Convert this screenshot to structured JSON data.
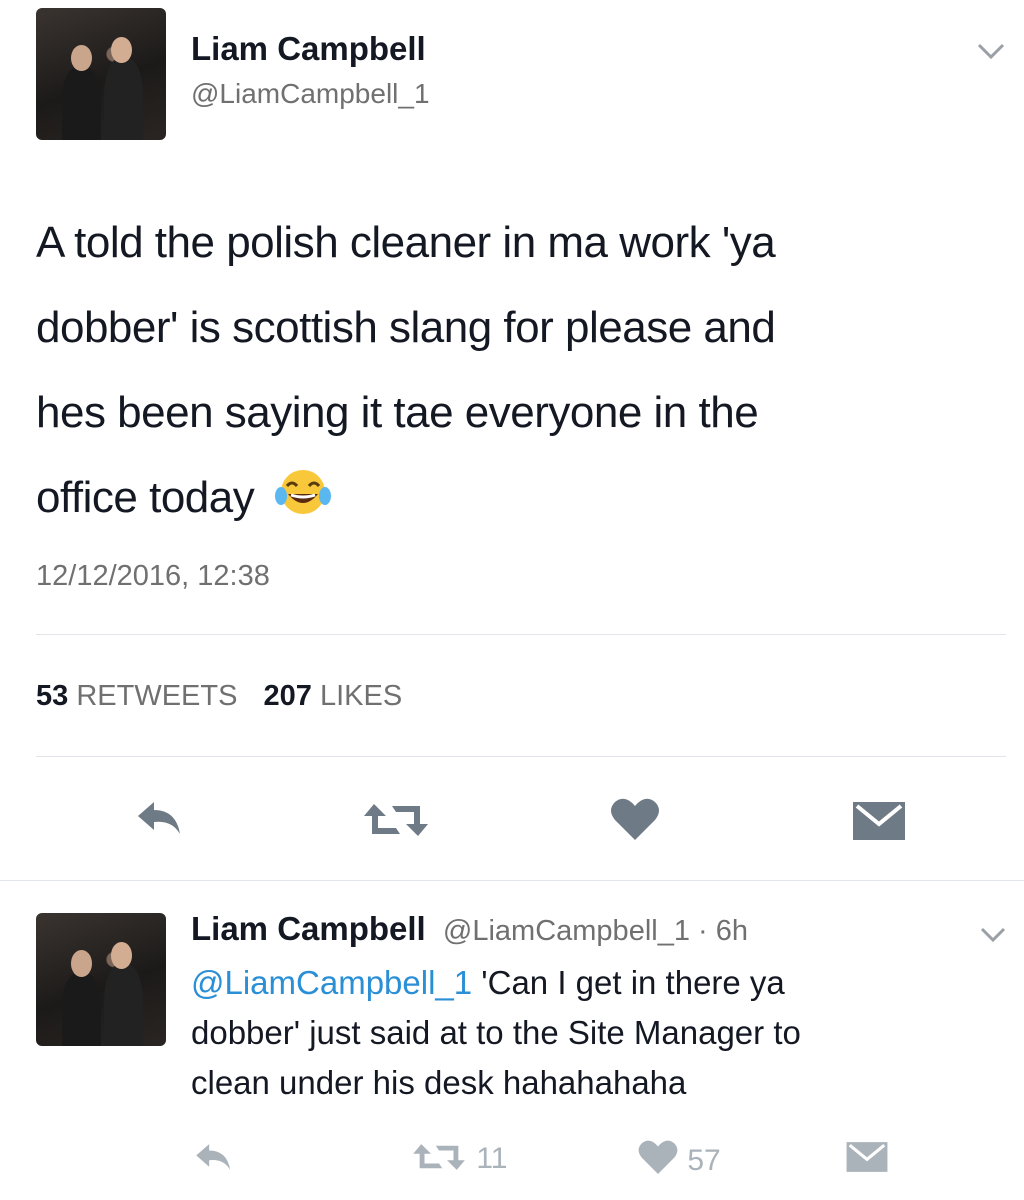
{
  "main_tweet": {
    "display_name": "Liam Campbell",
    "handle": "@LiamCampbell_1",
    "text_lines": [
      "A told the polish cleaner in ma work 'ya",
      "dobber' is scottish slang for please and",
      "hes been saying it tae everyone in the",
      "office today"
    ],
    "emoji": "😂",
    "timestamp": "12/12/2016, 12:38",
    "retweets_count": "53",
    "retweets_label": "RETWEETS",
    "likes_count": "207",
    "likes_label": "LIKES"
  },
  "reply_tweet": {
    "display_name": "Liam Campbell",
    "handle": "@LiamCampbell_1 · 6h",
    "mention": "@LiamCampbell_1",
    "text_first": " 'Can I get in there ya",
    "text_lines": [
      "dobber' just said at to the Site Manager to",
      "clean under his desk hahahahaha"
    ],
    "retweet_count": "11",
    "like_count": "57"
  },
  "icons": [
    "chevron-down-icon",
    "reply-icon",
    "retweet-icon",
    "heart-icon",
    "message-icon"
  ]
}
